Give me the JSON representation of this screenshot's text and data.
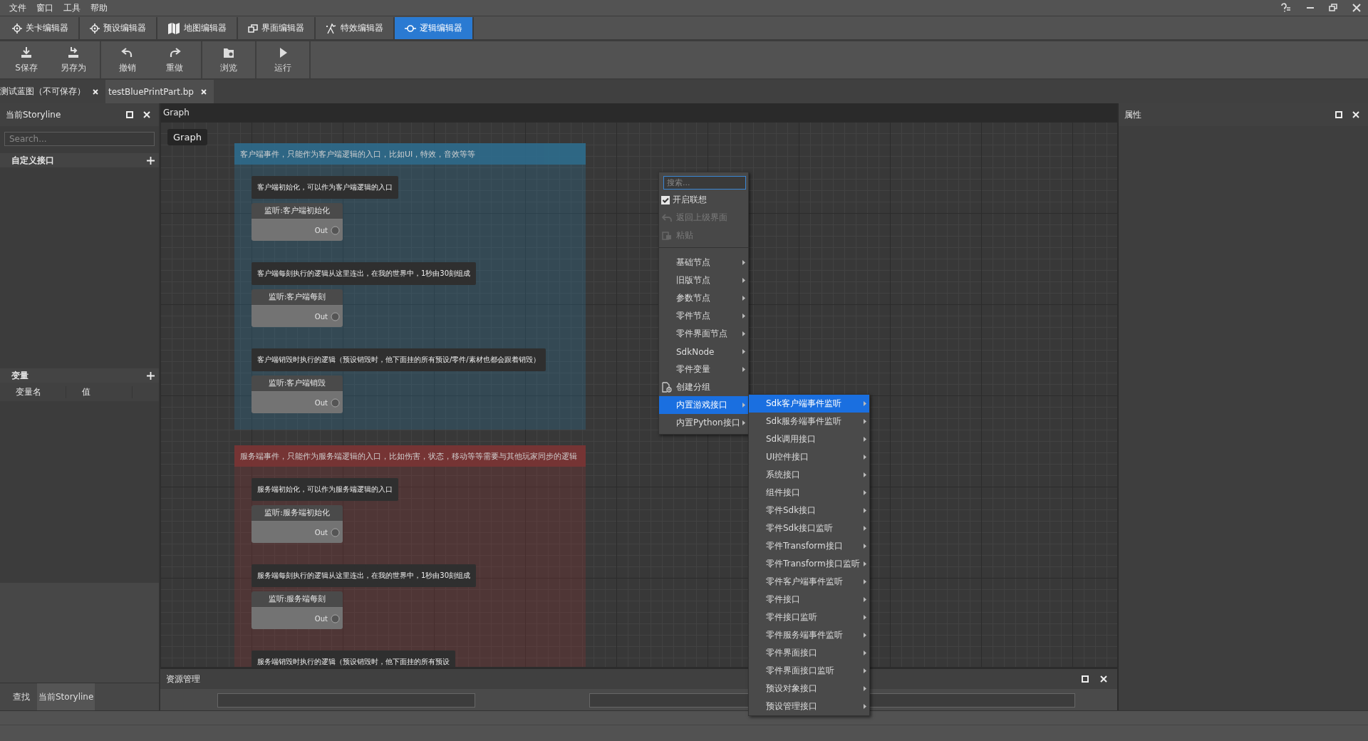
{
  "menu_bar": {
    "items": [
      "文件",
      "窗口",
      "工具",
      "帮助"
    ]
  },
  "editor_tabs": [
    {
      "label": "关卡编辑器",
      "selected": false
    },
    {
      "label": "预设编辑器",
      "selected": false
    },
    {
      "label": "地图编辑器",
      "selected": false
    },
    {
      "label": "界面编辑器",
      "selected": false
    },
    {
      "label": "特效编辑器",
      "selected": false
    },
    {
      "label": "逻辑编辑器",
      "selected": true
    }
  ],
  "toolbar": {
    "groups": [
      [
        "S保存",
        "另存为"
      ],
      [
        "撤销",
        "重做"
      ],
      [
        "浏览"
      ],
      [
        "运行"
      ]
    ]
  },
  "doc_tabs": [
    {
      "label": "测试蓝图（不可保存）",
      "selected": false
    },
    {
      "label": "testBluePrintPart.bp",
      "selected": true
    }
  ],
  "left_panel": {
    "title": "当前Storyline",
    "search_placeholder": "Search...",
    "custom_interface": "自定义接口",
    "variables": {
      "title": "变量",
      "columns": [
        "变量名",
        "值"
      ]
    },
    "bottom_tabs": [
      {
        "label": "查找",
        "selected": false
      },
      {
        "label": "当前Storyline",
        "selected": true
      }
    ]
  },
  "graph": {
    "title": "Graph",
    "breadcrumb": "Graph",
    "groups": [
      {
        "title": "客户端事件，只能作为客户端逻辑的入口，比如UI，特效，音效等等",
        "color": "#2e6a8a",
        "nodes": [
          {
            "comment": "客户端初始化，可以作为客户端逻辑的入口",
            "title": "监听:客户端初始化",
            "pin": "Out"
          },
          {
            "comment": "客户端每刻执行的逻辑从这里连出，在我的世界中，1秒由30刻组成",
            "title": "监听:客户端每刻",
            "pin": "Out"
          },
          {
            "comment": "客户端销毁时执行的逻辑（预设销毁时，他下面挂的所有预设/零件/素材也都会跟着销毁）",
            "title": "监听:客户端销毁",
            "pin": "Out"
          }
        ]
      },
      {
        "title": "服务端事件，只能作为服务端逻辑的入口，比如伤害，状态，移动等等需要与其他玩家同步的逻辑",
        "color": "#7a3434",
        "nodes": [
          {
            "comment": "服务端初始化，可以作为服务端逻辑的入口",
            "title": "监听:服务端初始化",
            "pin": "Out"
          },
          {
            "comment": "服务端每刻执行的逻辑从这里连出，在我的世界中，1秒由30刻组成",
            "title": "监听:服务端每刻",
            "pin": "Out"
          },
          {
            "comment": "服务端销毁时执行的逻辑（预设销毁时，他下面挂的所有预设"
          }
        ]
      }
    ]
  },
  "context_menu": {
    "search_placeholder": "搜索...",
    "items": [
      {
        "kind": "check",
        "label": "开启联想",
        "checked": true
      },
      {
        "kind": "back",
        "label": "返回上级界面",
        "disabled": true
      },
      {
        "kind": "paste",
        "label": "粘贴",
        "disabled": true
      },
      {
        "kind": "separator"
      },
      {
        "kind": "submenu",
        "label": "基础节点",
        "selected": false
      },
      {
        "kind": "submenu",
        "label": "旧版节点",
        "selected": false
      },
      {
        "kind": "submenu",
        "label": "参数节点",
        "selected": false
      },
      {
        "kind": "submenu",
        "label": "零件节点",
        "selected": false
      },
      {
        "kind": "submenu",
        "label": "零件界面节点",
        "selected": false
      },
      {
        "kind": "submenu",
        "label": "SdkNode",
        "selected": false
      },
      {
        "kind": "submenu",
        "label": "零件变量",
        "selected": false
      },
      {
        "kind": "group",
        "label": "创建分组"
      },
      {
        "kind": "submenu",
        "label": "内置游戏接口",
        "selected": true
      },
      {
        "kind": "submenu",
        "label": "内置Python接口",
        "selected": false
      }
    ],
    "submenu": [
      {
        "label": "Sdk客户端事件监听",
        "selected": true
      },
      {
        "label": "Sdk服务端事件监听",
        "selected": false
      },
      {
        "label": "Sdk调用接口",
        "selected": false
      },
      {
        "label": "UI控件接口",
        "selected": false
      },
      {
        "label": "系统接口",
        "selected": false
      },
      {
        "label": "组件接口",
        "selected": false
      },
      {
        "label": "零件Sdk接口",
        "selected": false
      },
      {
        "label": "零件Sdk接口监听",
        "selected": false
      },
      {
        "label": "零件Transform接口",
        "selected": false
      },
      {
        "label": "零件Transform接口监听",
        "selected": false
      },
      {
        "label": "零件客户端事件监听",
        "selected": false
      },
      {
        "label": "零件接口",
        "selected": false
      },
      {
        "label": "零件接口监听",
        "selected": false
      },
      {
        "label": "零件服务端事件监听",
        "selected": false
      },
      {
        "label": "零件界面接口",
        "selected": false
      },
      {
        "label": "零件界面接口监听",
        "selected": false
      },
      {
        "label": "预设对象接口",
        "selected": false
      },
      {
        "label": "预设管理接口",
        "selected": false
      }
    ]
  },
  "properties_panel": {
    "title": "属性"
  },
  "resource_panel": {
    "title": "资源管理"
  }
}
